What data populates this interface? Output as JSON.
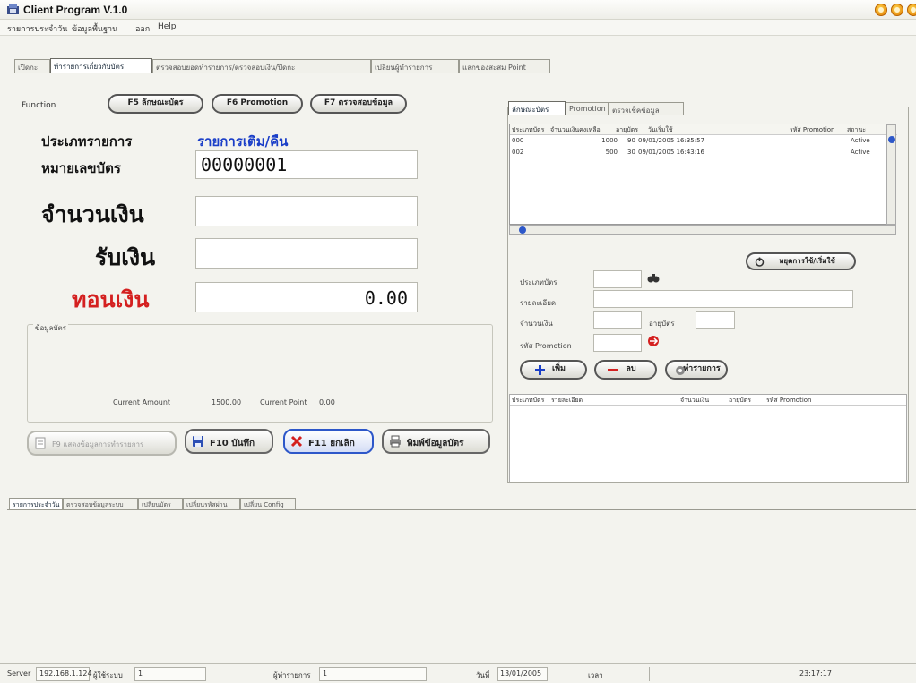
{
  "window": {
    "title": "Client Program V.1.0"
  },
  "menu": [
    "รายการประจำวัน",
    "ข้อมูลพื้นฐาน",
    "ออก",
    "Help"
  ],
  "main_tabs": [
    "เปิดกะ",
    "ทำรายการเกี่ยวกับบัตร",
    "ตรวจสอบยอดทำรายการ/ตรวจสอบเงิน/ปิดกะ",
    "เปลี่ยนผู้ทำรายการ",
    "แลกของสะสม Point"
  ],
  "function": {
    "label": "Function",
    "buttons": [
      "F5 ลักษณะบัตร",
      "F6 Promotion",
      "F7 ตรวจสอบข้อมูล"
    ]
  },
  "form": {
    "transaction_type_label": "ประเภทรายการ",
    "transaction_type_value": "รายการเติม/คืน",
    "card_no_label": "หมายเลขบัตร",
    "card_no_value": "00000001",
    "amount_label": "จำนวนเงิน",
    "amount_value": "",
    "received_label": "รับเงิน",
    "received_value": "",
    "change_label": "ทอนเงิน",
    "change_value": "0.00"
  },
  "card_info": {
    "title": "ข้อมูลบัตร",
    "current_amount_label": "Current Amount",
    "current_amount_value": "1500.00",
    "current_point_label": "Current Point",
    "current_point_value": "0.00"
  },
  "actions": [
    "F9 แสดงข้อมูลการทำรายการ",
    "F10 บันทึก",
    "F11 ยกเลิก",
    "พิมพ์ข้อมูลบัตร"
  ],
  "right_tabs": [
    "ลักษณะบัตร",
    "Promotion",
    "ตรวจเช็คข้อมูล"
  ],
  "card_table": {
    "headers": [
      "ประเภทบัตร",
      "จำนวนเงินคงเหลือ",
      "อายุบัตร",
      "วันเริ่มใช้",
      "รหัส Promotion",
      "สถานะ"
    ],
    "rows": [
      {
        "type": "000",
        "balance": "1000",
        "age": "90",
        "start": "09/01/2005 16:35:57",
        "promo": "",
        "status": "Active"
      },
      {
        "type": "002",
        "balance": "500",
        "age": "30",
        "start": "09/01/2005 16:43:16",
        "promo": "",
        "status": "Active"
      }
    ]
  },
  "detail": {
    "toggle_button": "หยุดการใช้/เริ่มใช้",
    "card_type_label": "ประเภทบัตร",
    "description_label": "รายละเอียด",
    "amount_label": "จำนวนเงิน",
    "card_age_label": "อายุบัตร",
    "promo_code_label": "รหัส Promotion",
    "buttons": [
      "เพิ่ม",
      "ลบ",
      "ทำรายการ"
    ]
  },
  "detail_table": {
    "headers": [
      "ประเภทบัตร",
      "รายละเอียด",
      "จำนวนเงิน",
      "อายุบัตร",
      "รหัส Promotion"
    ]
  },
  "bottom_tabs": [
    "รายการประจำวัน",
    "ตรวจสอบข้อมูลระบบ",
    "เปลี่ยนบัตร",
    "เปลี่ยนรหัสผ่าน",
    "เปลี่ยน Config"
  ],
  "status": {
    "server_label": "Server",
    "server_value": "192.168.1.124",
    "user_label": "ผู้ใช้ระบบ",
    "user_value": "1",
    "operator_label": "ผู้ทำรายการ",
    "operator_value": "1",
    "date_label": "วันที่",
    "date_value": "13/01/2005",
    "time_label": "เวลา",
    "time_value": "23:17:17"
  },
  "colors": {
    "accent_blue": "#1a3ec8",
    "change_red": "#d42020",
    "selected_blue": "#2d57c9"
  }
}
